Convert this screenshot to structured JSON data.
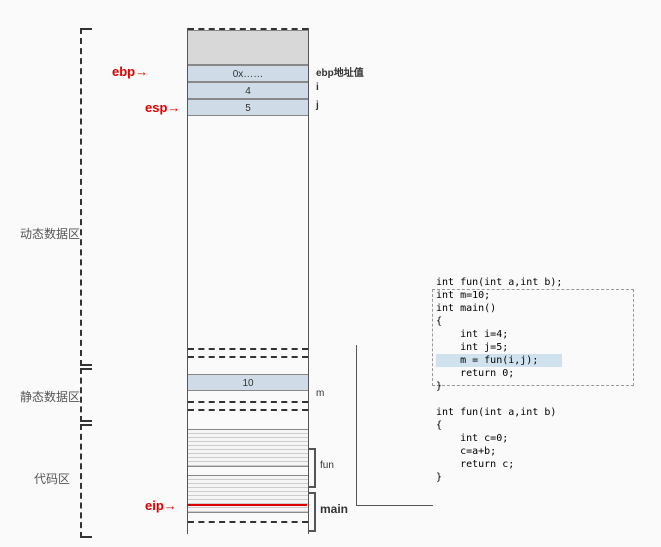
{
  "pointers": {
    "ebp": "ebp",
    "esp": "esp",
    "eip": "eip",
    "arrow": "→"
  },
  "regions": {
    "dynamic": "动态数据区",
    "static": "静态数据区",
    "code": "代码区"
  },
  "cells": {
    "addr": "0x……",
    "i": "4",
    "j": "5",
    "m": "10"
  },
  "cellLabels": {
    "addr": "ebp地址值",
    "i": "i",
    "j": "j",
    "m": "m",
    "fun": "fun",
    "main": "main"
  },
  "code": {
    "l1": "int fun(int a,int b);",
    "l2": "int m=10;",
    "l3": "int main()",
    "l4": "{",
    "l5": "    int i=4;",
    "l6": "    int j=5;",
    "l7": "    m = fun(i,j);",
    "l8": "    return 0;",
    "l9": "}",
    "l10": "int fun(int a,int b)",
    "l11": "{",
    "l12": "    int c=0;",
    "l13": "    c=a+b;",
    "l14": "    return c;",
    "l15": "}"
  }
}
